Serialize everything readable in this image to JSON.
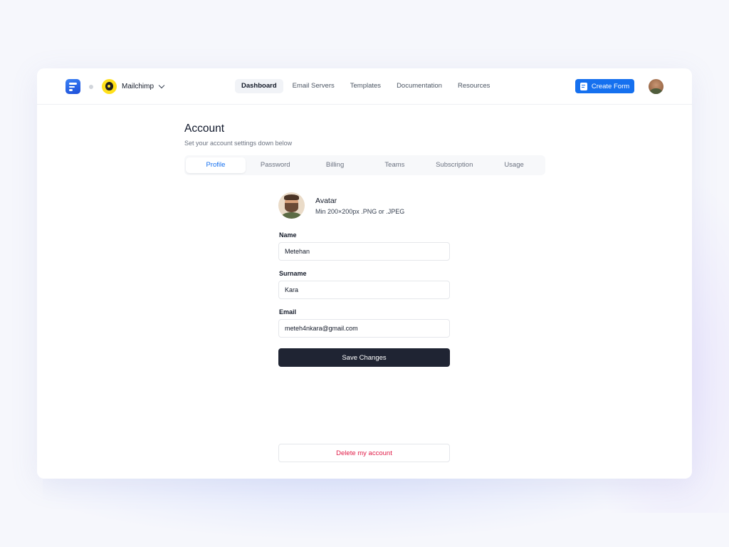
{
  "header": {
    "org_name": "Mailchimp",
    "nav": [
      {
        "label": "Dashboard",
        "active": true
      },
      {
        "label": "Email Servers",
        "active": false
      },
      {
        "label": "Templates",
        "active": false
      },
      {
        "label": "Documentation",
        "active": false
      },
      {
        "label": "Resources",
        "active": false
      }
    ],
    "create_label": "Create Form"
  },
  "page": {
    "title": "Account",
    "subtitle": "Set your account settings down below"
  },
  "tabs": [
    {
      "label": "Profile",
      "active": true
    },
    {
      "label": "Password",
      "active": false
    },
    {
      "label": "Billing",
      "active": false
    },
    {
      "label": "Teams",
      "active": false
    },
    {
      "label": "Subscription",
      "active": false
    },
    {
      "label": "Usage",
      "active": false
    }
  ],
  "profile": {
    "avatar_title": "Avatar",
    "avatar_hint": "Min 200×200px .PNG or .JPEG",
    "name_label": "Name",
    "name_value": "Metehan",
    "surname_label": "Surname",
    "surname_value": "Kara",
    "email_label": "Email",
    "email_value": "meteh4nkara@gmail.com",
    "save_label": "Save Changes",
    "delete_label": "Delete my account"
  },
  "colors": {
    "accent": "#1570ef",
    "primary_button": "#1f2433",
    "danger": "#e11d48",
    "brand_yellow": "#ffe01b"
  },
  "icons": {
    "app_logo": "app-logo-icon",
    "org_logo": "mailchimp-logo-icon",
    "dropdown": "chevron-down-icon",
    "create_form": "form-icon"
  }
}
